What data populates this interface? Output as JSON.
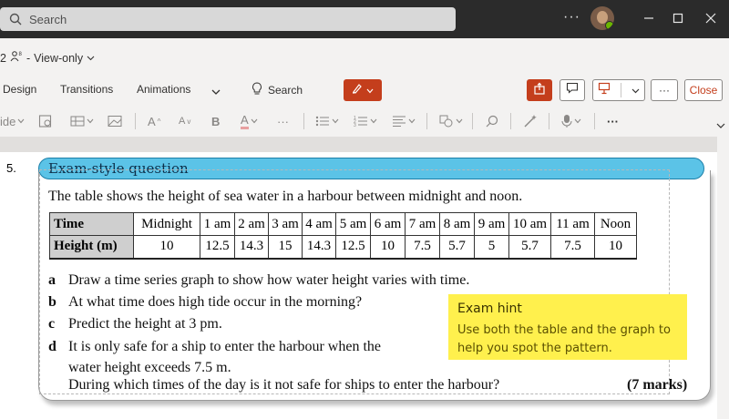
{
  "titlebar": {
    "search_placeholder": "Search",
    "more_label": "···"
  },
  "subbar": {
    "doc_prefix": "2 ",
    "view_mode": "View-only"
  },
  "ribbon": {
    "tabs": [
      "Design",
      "Transitions",
      "Animations"
    ],
    "search_label": "Search",
    "close_label": "Close",
    "more_label": "···"
  },
  "toolbar": {
    "left_fragment": "ide"
  },
  "slide": {
    "question_number": "5.",
    "question_title": "Exam-style question",
    "intro": "The table shows the height of sea water in a harbour between midnight and noon.",
    "table": {
      "row1_header": "Time",
      "times": [
        "Midnight",
        "1 am",
        "2 am",
        "3 am",
        "4 am",
        "5 am",
        "6 am",
        "7 am",
        "8 am",
        "9 am",
        "10 am",
        "11 am",
        "Noon"
      ],
      "row2_header": "Height (m)",
      "heights": [
        "10",
        "12.5",
        "14.3",
        "15",
        "14.3",
        "12.5",
        "10",
        "7.5",
        "5.7",
        "5",
        "5.7",
        "7.5",
        "10"
      ]
    },
    "questions": [
      {
        "letter": "a",
        "text": "Draw a time series graph to show how water height varies with time."
      },
      {
        "letter": "b",
        "text": "At what time does high tide occur in the morning?"
      },
      {
        "letter": "c",
        "text": "Predict the height at 3 pm."
      },
      {
        "letter": "d",
        "text": "It is only safe for a ship to enter the harbour when the"
      }
    ],
    "question_d_line2": "water height exceeds 7.5 m.",
    "question_d_line3": "During which times of the day is it not safe for ships to enter the harbour?",
    "marks": "(7 marks)",
    "hint_title": "Exam hint",
    "hint_text": "Use both the table and the graph to help you spot the pattern."
  },
  "colors": {
    "accent": "#c43e1c",
    "pill": "#5bc3e7",
    "hint": "#fff04d"
  }
}
